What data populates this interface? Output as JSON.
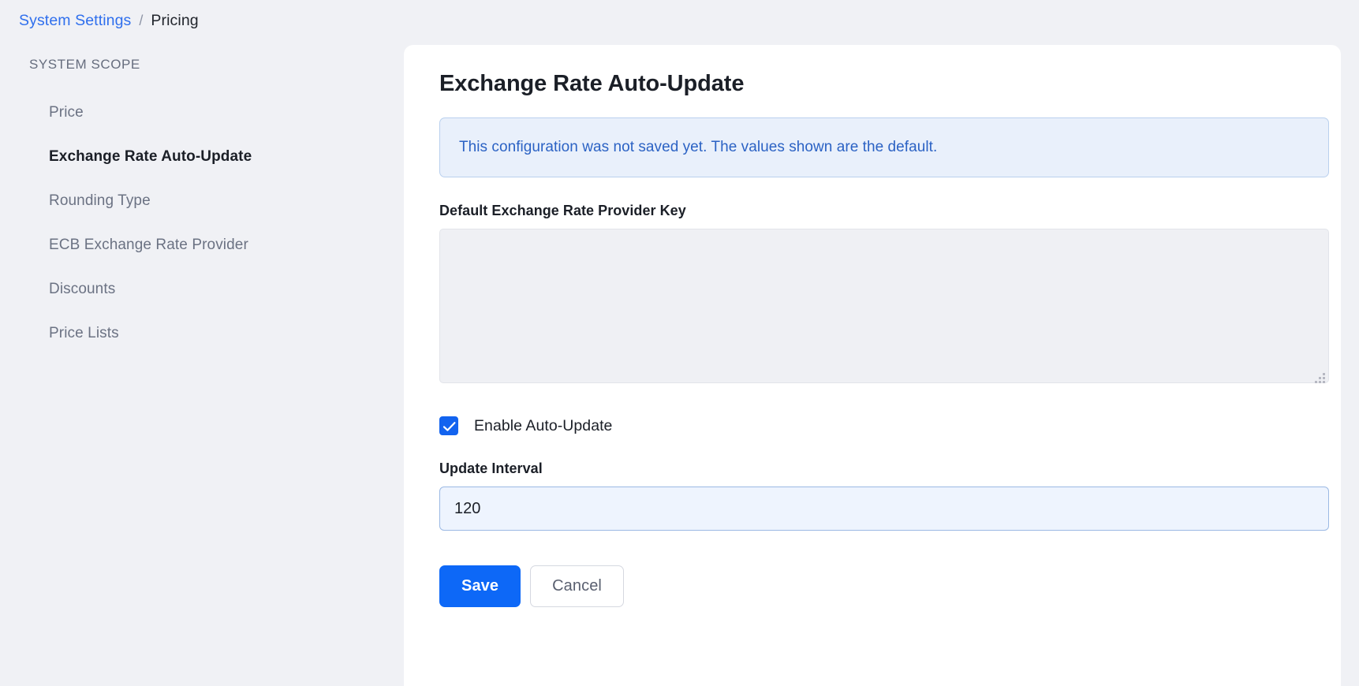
{
  "breadcrumb": {
    "parent_label": "System Settings",
    "separator": "/",
    "current_label": "Pricing"
  },
  "sidebar": {
    "heading": "SYSTEM SCOPE",
    "items": [
      {
        "label": "Price",
        "active": false
      },
      {
        "label": "Exchange Rate Auto-Update",
        "active": true
      },
      {
        "label": "Rounding Type",
        "active": false
      },
      {
        "label": "ECB Exchange Rate Provider",
        "active": false
      },
      {
        "label": "Discounts",
        "active": false
      },
      {
        "label": "Price Lists",
        "active": false
      }
    ]
  },
  "main": {
    "title": "Exchange Rate Auto-Update",
    "alert": {
      "text": "This configuration was not saved yet. The values shown are the default.",
      "type": "info",
      "text_color": "#2b62c4",
      "background_color": "#e9f0fb",
      "border_color": "#b9d0ee"
    },
    "provider_key_field": {
      "label": "Default Exchange Rate Provider Key",
      "value": "",
      "placeholder": ""
    },
    "enable_auto_update": {
      "label": "Enable Auto-Update",
      "checked": true,
      "accent_color": "#1263ef"
    },
    "update_interval_field": {
      "label": "Update Interval",
      "value": "120",
      "placeholder": "",
      "focused": true
    },
    "buttons": {
      "save_label": "Save",
      "cancel_label": "Cancel",
      "save_color": "#0d68f7"
    }
  },
  "colors": {
    "page_background": "#f0f1f5",
    "card_background": "#ffffff",
    "link": "#2f6fed",
    "text_primary": "#1b1f27",
    "text_muted": "#6b7283"
  }
}
